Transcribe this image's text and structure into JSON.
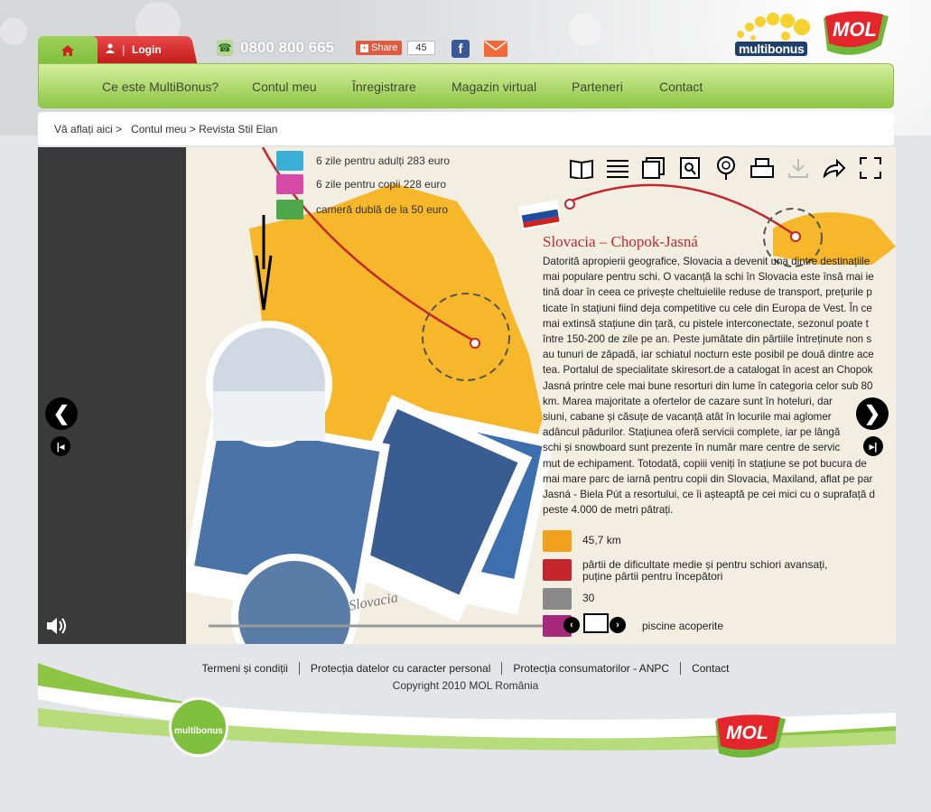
{
  "header": {
    "login_label": "Login",
    "phone": "0800 800 665",
    "share_label": "Share",
    "share_count": "45",
    "brand_multibonus": "multibonus",
    "brand_mol": "MOL"
  },
  "nav": {
    "items": [
      "Ce este MultiBonus?",
      "Contul meu",
      "Înregistrare",
      "Magazin virtual",
      "Parteneri",
      "Contact"
    ]
  },
  "breadcrumb": {
    "prefix": "Vă aflați aici >",
    "path": "Contul meu > Revista Stil Elan"
  },
  "magazine": {
    "prices": [
      "6 zile pentru adulți 283 euro",
      "6 zile pentru copii 228 euro",
      "cameră dublă de la 50 euro"
    ],
    "title": "Slovacia – Chopok-Jasná",
    "body": "Datorită apropierii geografice, Slovacia a devenit una dintre destinațiile\nmai populare pentru schi. O vacanță la schi în Slovacia este însă mai ie\ntină doar în ceea ce privește cheltuielile reduse de transport, prețurile p\nticate în stațiuni fiind deja competitive cu cele din Europa de Vest. În ce\nmai extinsă stațiune din țară, cu pistele interconectate, sezonul poate t\nîntre 150-200 de zile pe an. Peste jumătate din pârtiile întreținute non s\nau tunuri de zăpadă, iar schiatul nocturn este posibil pe două dintre ace\ntea. Portalul de specialitate skiresort.de a catalogat în acest an Chopok\nJasná printre cele mai bune resorturi din lume în categoria celor sub 80\nkm. Marea majoritate a ofertelor de cazare sunt în hoteluri, dar\nsiuni, cabane și căsuțe de vacanță atât în locurile mai aglomer\nadâncul pădurilor. Stațiunea oferă servicii complete, iar pe lângă\nschi și snowboard sunt prezente în număr mare centre de servic\nmut de echipament. Totodată, copiii veniți în stațiune se pot bucura de\nmai mare parc de iarnă pentru copii din Slovacia, Maxiland, aflat pe par\nJasná - Biela Pút a resortului, ce îi așteaptă pe cei mici cu o suprafață d\npeste 4.000 de metri pătrați.",
    "info": [
      "45,7 km",
      "pârtii de dificultate medie și pentru schiori avansați,\npuține pârtii pentru începători",
      "30",
      "piscine acoperite"
    ],
    "photo_caption": "Slovacia"
  },
  "footer": {
    "links": [
      "Termeni și condiții",
      "Protecția datelor cu caracter personal",
      "Protecția consumatorilor - ANPC",
      "Contact"
    ],
    "copyright": "Copyright 2010 MOL România"
  },
  "colors": {
    "nav_green": "#8dc645",
    "login_red": "#c41c1c",
    "title_red": "#c4262e",
    "map_orange": "#f6b72a"
  }
}
